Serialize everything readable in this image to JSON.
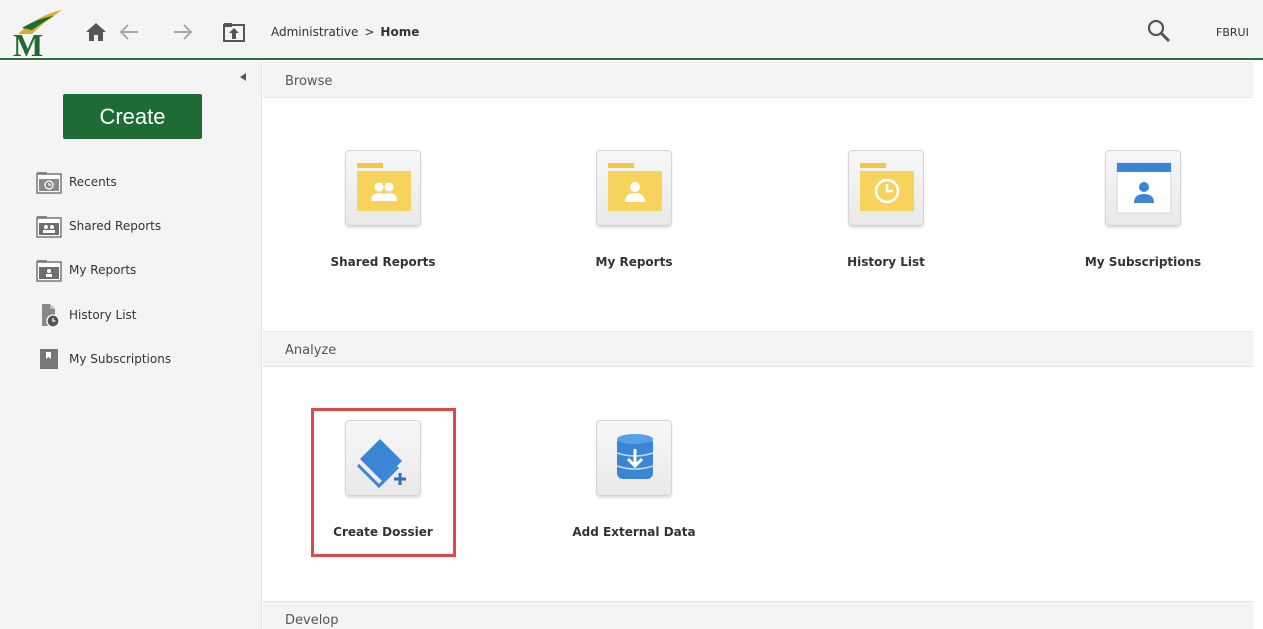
{
  "header": {
    "breadcrumb_root": "Administrative",
    "breadcrumb_sep": ">",
    "breadcrumb_current": "Home",
    "user": "FBRUI"
  },
  "sidebar": {
    "create_label": "Create",
    "items": [
      {
        "label": "Recents",
        "icon": "recents-folder-icon"
      },
      {
        "label": "Shared Reports",
        "icon": "shared-reports-folder-icon"
      },
      {
        "label": "My Reports",
        "icon": "my-reports-folder-icon"
      },
      {
        "label": "History List",
        "icon": "history-list-icon"
      },
      {
        "label": "My Subscriptions",
        "icon": "subscriptions-icon"
      }
    ]
  },
  "sections": {
    "browse": {
      "title": "Browse",
      "tiles": [
        {
          "label": "Shared Reports",
          "icon": "shared-reports-folder-icon"
        },
        {
          "label": "My Reports",
          "icon": "my-reports-folder-icon"
        },
        {
          "label": "History List",
          "icon": "history-list-folder-icon"
        },
        {
          "label": "My Subscriptions",
          "icon": "subscriptions-icon"
        }
      ]
    },
    "analyze": {
      "title": "Analyze",
      "tiles": [
        {
          "label": "Create Dossier",
          "icon": "create-dossier-icon"
        },
        {
          "label": "Add External Data",
          "icon": "add-external-data-icon"
        }
      ]
    },
    "develop": {
      "title": "Develop"
    }
  },
  "colors": {
    "brand_green": "#1f6b35",
    "folder_yellow": "#f7d25c",
    "accent_blue": "#3a86d4",
    "highlight_red": "#e04848"
  }
}
